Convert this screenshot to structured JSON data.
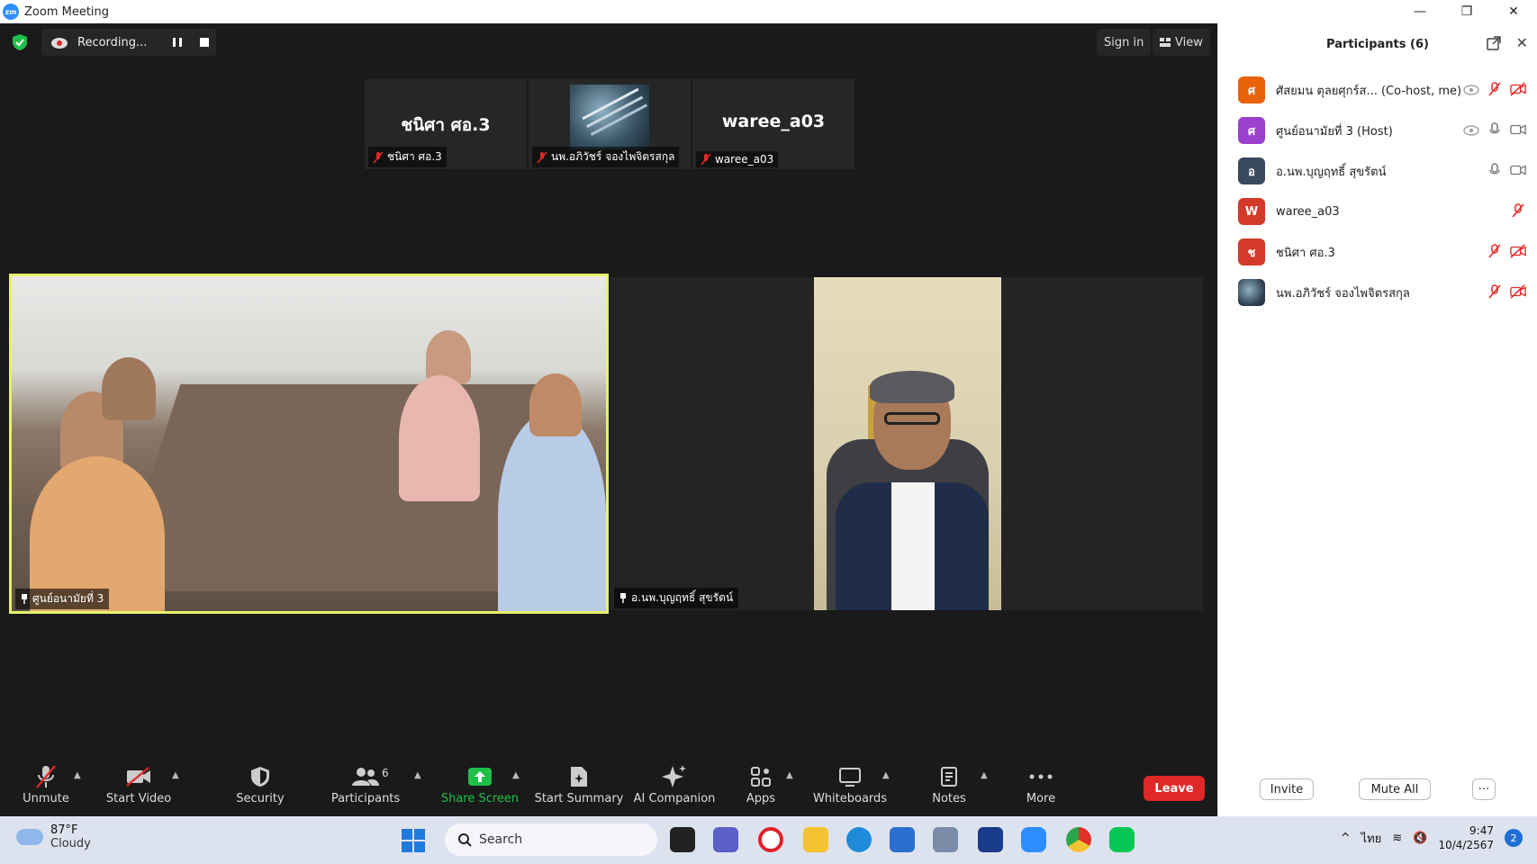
{
  "window": {
    "title": "Zoom Meeting",
    "controls": [
      "—",
      "❐",
      "✕"
    ]
  },
  "meeting": {
    "recording_label": "Recording...",
    "sign_in": "Sign in",
    "view": "View",
    "thumbnails": [
      {
        "big_name": "ชนิศา ศอ.3",
        "label": "ชนิศา ศอ.3"
      },
      {
        "big_name": "",
        "label": "นพ.อภิวัชร์ จองไพจิตรสกุล"
      },
      {
        "big_name": "waree_a03",
        "label": "waree_a03"
      }
    ],
    "videos": [
      {
        "label": "ศูนย์อนามัยที่ 3"
      },
      {
        "label": "อ.นพ.บุญฤทธิ์ สุขรัตน์"
      }
    ]
  },
  "toolbar": {
    "unmute": "Unmute",
    "start_video": "Start Video",
    "security": "Security",
    "participants": "Participants",
    "participants_count": "6",
    "share_screen": "Share Screen",
    "start_summary": "Start Summary",
    "ai_companion": "AI Companion",
    "apps": "Apps",
    "whiteboards": "Whiteboards",
    "notes": "Notes",
    "more": "More",
    "leave": "Leave"
  },
  "panel": {
    "title": "Participants (6)",
    "participants": [
      {
        "initial": "ศ",
        "name": "ศัสยมน ตุลยศุกร์ส... (Co-host, me)",
        "color": "#e8630a"
      },
      {
        "initial": "ศ",
        "name": "ศูนย์อนามัยที่ 3 (Host)",
        "color": "#9b3fcf"
      },
      {
        "initial": "อ",
        "name": "อ.นพ.บุญฤทธิ์ สุขรัตน์",
        "color": "#3a4a5e"
      },
      {
        "initial": "W",
        "name": "waree_a03",
        "color": "#d43a2a"
      },
      {
        "initial": "ช",
        "name": "ชนิศา ศอ.3",
        "color": "#d43a2a"
      },
      {
        "initial": "",
        "name": "นพ.อภิวัชร์ จองไพจิตรสกุล",
        "color": "#2a3a4a"
      }
    ],
    "invite": "Invite",
    "mute_all": "Mute All",
    "more": "···"
  },
  "taskbar": {
    "temperature": "87°F",
    "weather": "Cloudy",
    "search": "Search",
    "language": "ไทย",
    "time": "9:47",
    "date": "10/4/2567",
    "notifications": "2"
  },
  "colors": {
    "accent_green": "#1fbf4a",
    "leave_red": "#e02828",
    "active_border": "#e6f26a"
  }
}
